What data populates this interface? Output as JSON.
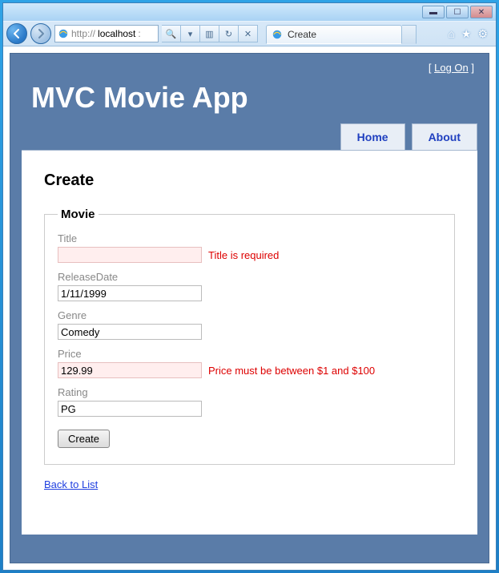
{
  "window": {
    "min": "▁",
    "max": "▢",
    "close": "✕"
  },
  "addressbar": {
    "url_prefix": "http://",
    "url_host": "localhost",
    "url_suffix": ":"
  },
  "tab": {
    "title": "Create"
  },
  "header": {
    "logon_left": "[ ",
    "logon_link": "Log On",
    "logon_right": " ]",
    "site_title": "MVC Movie App",
    "nav": {
      "home": "Home",
      "about": "About"
    }
  },
  "page": {
    "heading": "Create",
    "legend": "Movie",
    "fields": {
      "title": {
        "label": "Title",
        "value": "",
        "error": "Title is required"
      },
      "releaseDate": {
        "label": "ReleaseDate",
        "value": "1/11/1999",
        "error": ""
      },
      "genre": {
        "label": "Genre",
        "value": "Comedy",
        "error": ""
      },
      "price": {
        "label": "Price",
        "value": "129.99",
        "error": "Price must be between $1 and $100"
      },
      "rating": {
        "label": "Rating",
        "value": "PG",
        "error": ""
      }
    },
    "submit_label": "Create",
    "back_link": "Back to List"
  }
}
